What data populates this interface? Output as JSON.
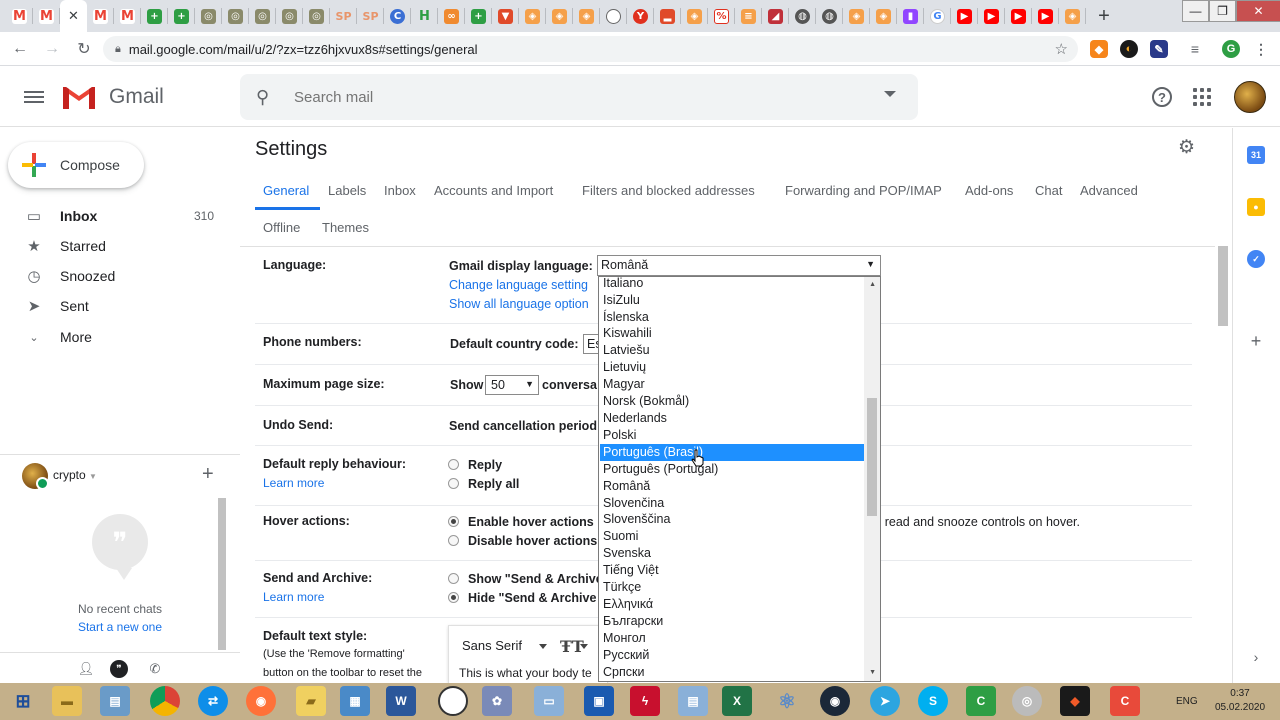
{
  "browser": {
    "url": "mail.google.com/mail/u/2/?zx=tzz6hjxvux8s#settings/general"
  },
  "gmail": {
    "product_name": "Gmail",
    "search_placeholder": "Search mail",
    "compose_label": "Compose",
    "nav": [
      {
        "label": "Inbox",
        "count": "310",
        "icon": "inbox-icon"
      },
      {
        "label": "Starred",
        "count": "",
        "icon": "star-icon"
      },
      {
        "label": "Snoozed",
        "count": "",
        "icon": "clock-icon"
      },
      {
        "label": "Sent",
        "count": "",
        "icon": "send-icon"
      },
      {
        "label": "More",
        "count": "",
        "icon": "chevron-down-icon"
      }
    ],
    "hangouts": {
      "user": "crypto",
      "no_chats": "No recent chats",
      "start_chat": "Start a new one"
    }
  },
  "settings": {
    "title": "Settings",
    "tabs_row1": [
      "General",
      "Labels",
      "Inbox",
      "Accounts and Import",
      "Filters and blocked addresses",
      "Forwarding and POP/IMAP",
      "Add-ons",
      "Chat",
      "Advanced"
    ],
    "tabs_row2": [
      "Offline",
      "Themes"
    ],
    "active_tab": "General",
    "language": {
      "label": "Language:",
      "display_label": "Gmail display language:",
      "selected": "Română",
      "change_link": "Change language setting",
      "show_all_link": "Show all language option"
    },
    "phone": {
      "label": "Phone numbers:",
      "country_label": "Default country code:",
      "country_value": "Es"
    },
    "page_size": {
      "label": "Maximum page size:",
      "show": "Show",
      "value": "50",
      "suffix": "conversa"
    },
    "undo_send": {
      "label": "Undo Send:",
      "text": "Send cancellation period"
    },
    "reply": {
      "label": "Default reply behaviour:",
      "learn_more": "Learn more",
      "options": [
        "Reply",
        "Reply all"
      ]
    },
    "hover": {
      "label": "Hover actions:",
      "options": [
        "Enable hover actions",
        "Disable hover actions"
      ],
      "tail": "s read and snooze controls on hover."
    },
    "send_archive": {
      "label": "Send and Archive:",
      "learn_more": "Learn more",
      "options": [
        "Show \"Send & Archive",
        "Hide \"Send & Archive"
      ]
    },
    "text_style": {
      "label": "Default text style:",
      "hint1": "(Use the 'Remove formatting'",
      "hint2": "button on the toolbar to reset the",
      "font": "Sans Serif",
      "preview": "This is what your body te"
    }
  },
  "language_dropdown": {
    "options": [
      "Italiano",
      "IsiZulu",
      "Íslenska",
      "Kiswahili",
      "Latviešu",
      "Lietuvių",
      "Magyar",
      "Norsk (Bokmål)",
      "Nederlands",
      "Polski",
      "Português (Brasil)",
      "Português (Portugal)",
      "Română",
      "Slovenčina",
      "Slovenščina",
      "Suomi",
      "Svenska",
      "Tiếng Việt",
      "Türkçe",
      "Ελληνικά",
      "Български",
      "Монгол",
      "Русский",
      "Српски"
    ],
    "highlighted": "Português (Brasil)"
  },
  "taskbar": {
    "lang": "ENG",
    "time": "0:37",
    "date": "05.02.2020"
  },
  "colors": {
    "accent": "#1a73e8",
    "gmail_red": "#ea4335",
    "selection": "#1e90ff"
  }
}
